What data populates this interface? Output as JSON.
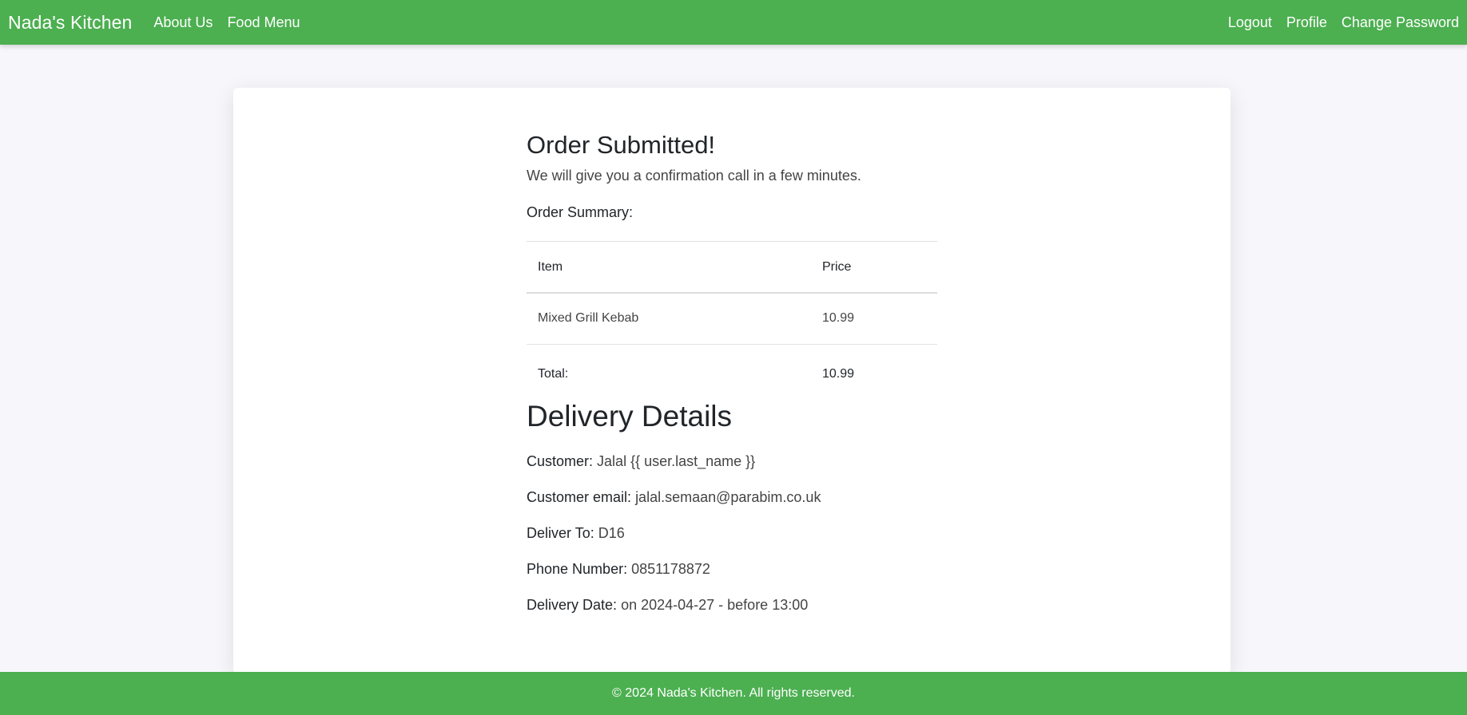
{
  "navbar": {
    "brand": "Nada's Kitchen",
    "left_links": [
      "About Us",
      "Food Menu"
    ],
    "right_links": [
      "Logout",
      "Profile",
      "Change Password"
    ]
  },
  "order": {
    "title": "Order Submitted!",
    "subtitle": "We will give you a confirmation call in a few minutes.",
    "summary_heading": "Order Summary:",
    "columns": [
      "Item",
      "Price"
    ],
    "items": [
      {
        "name": "Mixed Grill Kebab",
        "price": "10.99"
      }
    ],
    "total_label": "Total:",
    "total_value": "10.99"
  },
  "delivery": {
    "title": "Delivery Details",
    "fields": [
      {
        "label": "Customer:",
        "value": "Jalal {{ user.last_name }}"
      },
      {
        "label": "Customer email:",
        "value": "jalal.semaan@parabim.co.uk"
      },
      {
        "label": "Deliver To:",
        "value": "D16"
      },
      {
        "label": "Phone Number:",
        "value": "0851178872"
      },
      {
        "label": "Delivery Date:",
        "value": "on 2024-04-27 - before 13:00"
      }
    ]
  },
  "footer": {
    "text": "© 2024 Nada's Kitchen. All rights reserved."
  },
  "colors": {
    "brand_green": "#4caf50",
    "page_background": "#f7f7fb"
  }
}
